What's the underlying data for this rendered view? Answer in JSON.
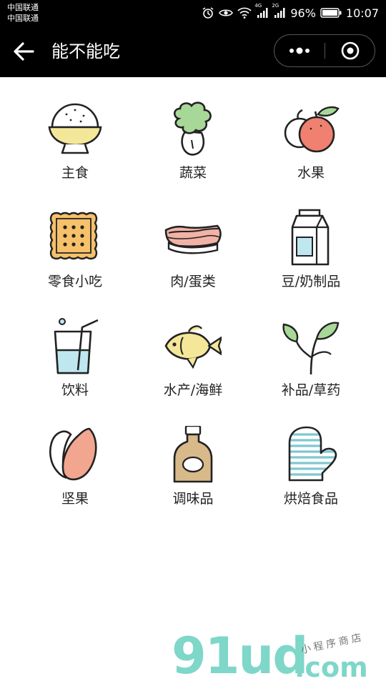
{
  "status_bar": {
    "carrier_1": "中国联通",
    "carrier_2": "中国联通",
    "signal_1_label": "4G",
    "signal_2_label": "2G",
    "battery": "96%",
    "time": "10:07"
  },
  "nav": {
    "title": "能不能吃"
  },
  "categories": [
    {
      "label": "主食",
      "icon": "rice-bowl-icon"
    },
    {
      "label": "蔬菜",
      "icon": "vegetable-icon"
    },
    {
      "label": "水果",
      "icon": "fruit-icon"
    },
    {
      "label": "零食小吃",
      "icon": "biscuit-icon"
    },
    {
      "label": "肉/蛋类",
      "icon": "meat-icon"
    },
    {
      "label": "豆/奶制品",
      "icon": "milk-carton-icon"
    },
    {
      "label": "饮料",
      "icon": "drink-cup-icon"
    },
    {
      "label": "水产/海鲜",
      "icon": "fish-icon"
    },
    {
      "label": "补品/草药",
      "icon": "herb-leaf-icon"
    },
    {
      "label": "坚果",
      "icon": "nut-icon"
    },
    {
      "label": "调味品",
      "icon": "sauce-bottle-icon"
    },
    {
      "label": "烘焙食品",
      "icon": "oven-mitt-icon"
    }
  ],
  "watermark": {
    "brand": "91ud",
    "domain": ".com",
    "tagline": "小程序商店"
  },
  "colors": {
    "bar_bg": "#000000",
    "yellow": "#f5e79a",
    "green": "#a8d898",
    "red": "#f08070",
    "orange": "#f6c16a",
    "pink": "#f2b2a6",
    "blue": "#bfe7f0",
    "brown": "#d8b98a",
    "watermark": "#7ed7c8"
  }
}
